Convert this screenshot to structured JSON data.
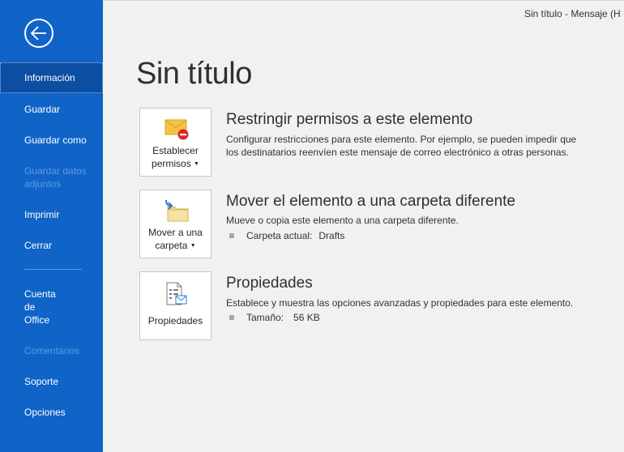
{
  "window": {
    "title": "Sin título  -  Mensaje (H"
  },
  "sidebar": {
    "items": [
      {
        "label": "Información"
      },
      {
        "label": "Guardar"
      },
      {
        "label": "Guardar como"
      },
      {
        "label": "Guardar datos adjuntos",
        "line1": "Guardar datos",
        "line2": "adjuntos"
      },
      {
        "label": "Imprimir"
      },
      {
        "label": "Cerrar"
      },
      {
        "label": "Cuenta de Office",
        "line1": "Cuenta",
        "line2": "de",
        "line3": "Office"
      },
      {
        "label": "Comentarios"
      },
      {
        "label": "Soporte"
      },
      {
        "label": "Opciones"
      }
    ]
  },
  "main": {
    "title": "Sin título",
    "sections": [
      {
        "button_line1": "Establecer",
        "button_line2": "permisos",
        "icon": "envelope-restrict-icon",
        "title": "Restringir permisos a este elemento",
        "desc1": "Configurar restricciones para este elemento. Por ejemplo, se pueden impedir que",
        "desc2": "los destinatarios reenvíen este mensaje de correo electrónico a otras personas."
      },
      {
        "button_line1": "Mover a una",
        "button_line2": "carpeta",
        "icon": "move-folder-icon",
        "title": "Mover el elemento a una carpeta diferente",
        "desc1": "Mueve o copia este elemento a una carpeta diferente.",
        "detail_label": "Carpeta actual:",
        "detail_value": "Drafts"
      },
      {
        "button_line1": "Propiedades",
        "icon": "properties-icon",
        "title": "Propiedades",
        "desc1": "Establece y muestra las opciones avanzadas y propiedades para este elemento.",
        "detail_label": "Tamaño:",
        "detail_value": "56 KB"
      }
    ]
  },
  "colors": {
    "sidebar": "#1064c7",
    "sidebar_active": "#0b4ea2",
    "background": "#f1f1f1"
  }
}
